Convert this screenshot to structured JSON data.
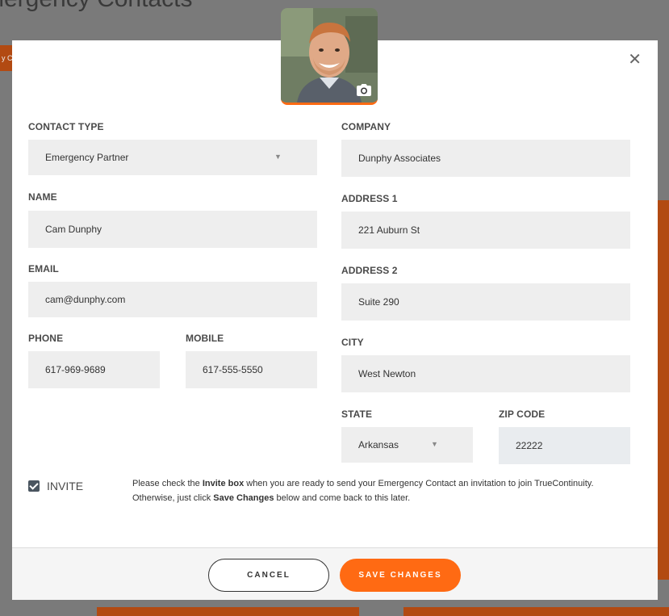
{
  "background": {
    "page_title": "Emergency Contacts",
    "tab_label": "y C"
  },
  "modal": {
    "close_glyph": "✕",
    "form": {
      "contact_type": {
        "label": "CONTACT TYPE",
        "value": "Emergency Partner"
      },
      "name": {
        "label": "NAME",
        "value": "Cam Dunphy"
      },
      "email": {
        "label": "EMAIL",
        "value": "cam@dunphy.com"
      },
      "phone": {
        "label": "PHONE",
        "value": "617-969-9689"
      },
      "mobile": {
        "label": "MOBILE",
        "value": "617-555-5550"
      },
      "company": {
        "label": "COMPANY",
        "value": "Dunphy Associates"
      },
      "address1": {
        "label": "ADDRESS 1",
        "value": "221 Auburn St"
      },
      "address2": {
        "label": "ADDRESS 2",
        "value": "Suite 290"
      },
      "city": {
        "label": "CITY",
        "value": "West Newton"
      },
      "state": {
        "label": "STATE",
        "value": "Arkansas"
      },
      "zip": {
        "label": "ZIP CODE",
        "value": "22222"
      }
    },
    "invite": {
      "label": "INVITE",
      "checked": true,
      "text_1": "Please check the ",
      "text_bold_1": "Invite box",
      "text_2": " when you are ready to send your Emergency Contact an invitation to join TrueContinuity.",
      "text_3": "Otherwise, just click ",
      "text_bold_2": "Save Changes",
      "text_4": " below and come back to this later."
    },
    "buttons": {
      "cancel": "CANCEL",
      "save": "SAVE CHANGES"
    }
  },
  "colors": {
    "accent": "#ff6a13",
    "field_bg": "#eeeeee",
    "label": "#4a4a4a"
  }
}
